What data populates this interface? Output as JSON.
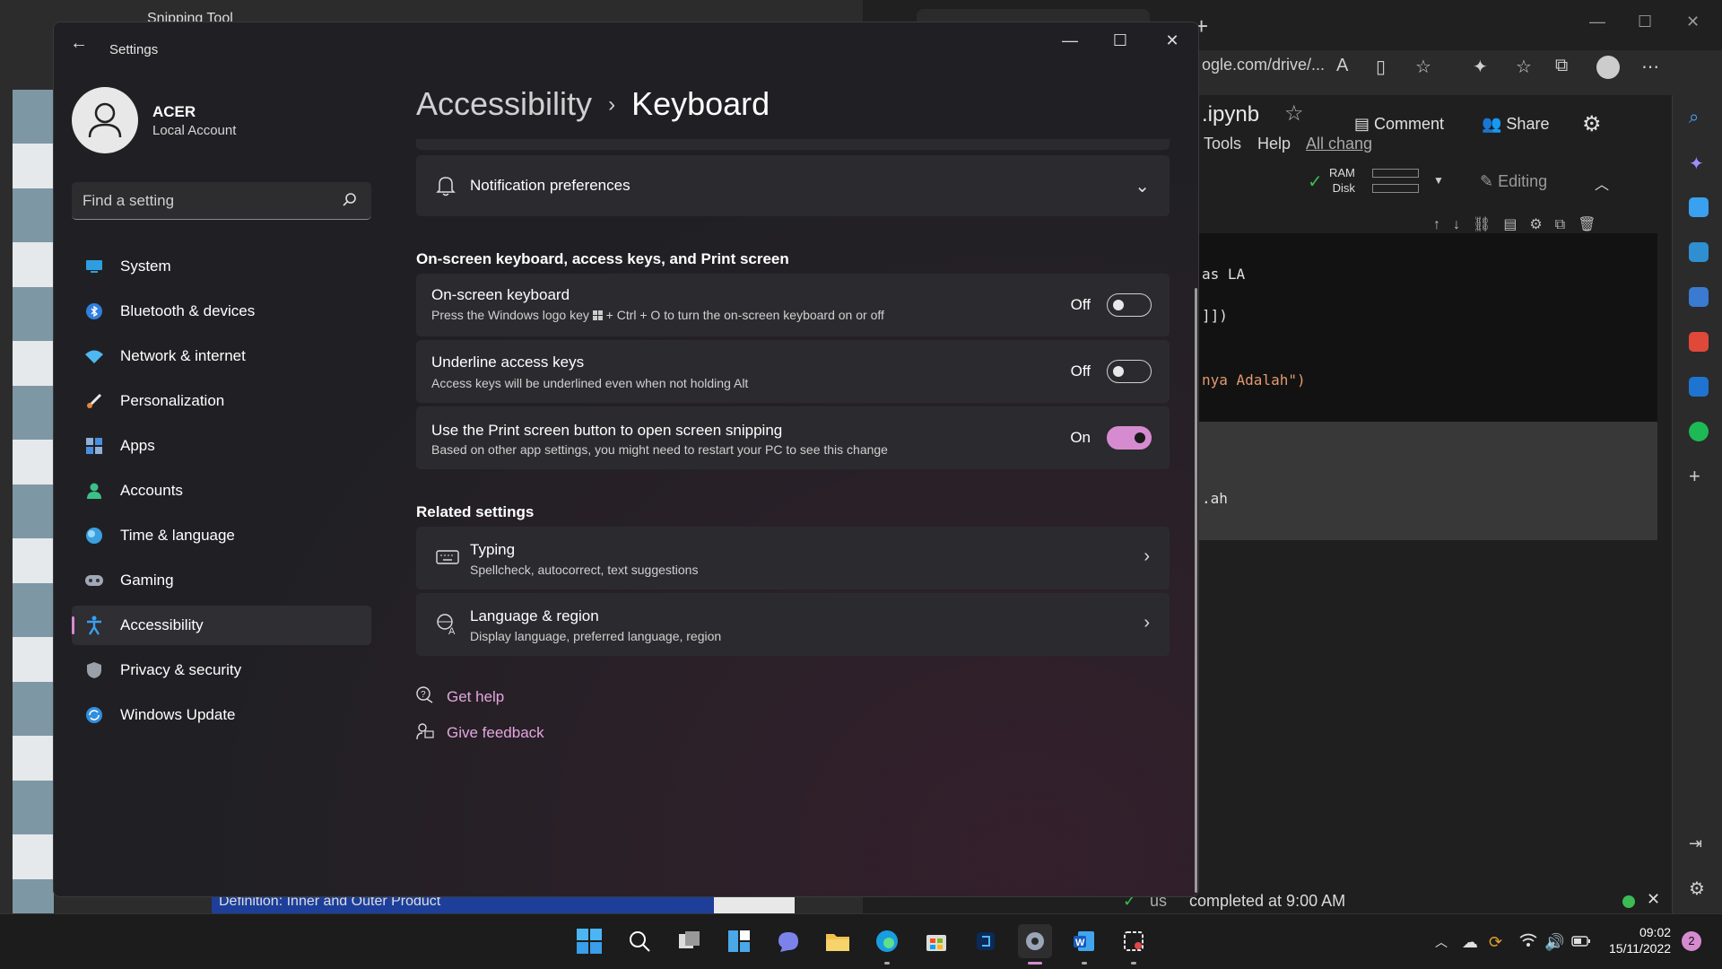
{
  "background": {
    "snipping_tool": {
      "title": "Snipping Tool",
      "definition_text": "Definition: Inner and Outer Product"
    },
    "browser": {
      "url": "ogle.com/drive/...",
      "notebook_title": ".ipynb",
      "menu": [
        "Tools",
        "Help"
      ],
      "all_changes": "All chang",
      "comment_label": "Comment",
      "share_label": "Share",
      "ram_label": "RAM",
      "disk_label": "Disk",
      "editing_label": "Editing",
      "code_lines": [
        "as LA",
        "]])",
        "nya Adalah\")",
        ".ah"
      ],
      "status_us": "us",
      "status_text": "completed at 9:00 AM"
    }
  },
  "settings": {
    "window_title": "Settings",
    "profile": {
      "name": "ACER",
      "account_type": "Local Account"
    },
    "search": {
      "placeholder": "Find a setting"
    },
    "nav": [
      {
        "label": "System",
        "icon": "system-icon",
        "color": "#2f9ee0"
      },
      {
        "label": "Bluetooth & devices",
        "icon": "bluetooth-icon",
        "color": "#2f7fe0"
      },
      {
        "label": "Network & internet",
        "icon": "wifi-icon",
        "color": "#4fb8f0"
      },
      {
        "label": "Personalization",
        "icon": "brush-icon",
        "color": "#e08a3c"
      },
      {
        "label": "Apps",
        "icon": "apps-icon",
        "color": "#8fb0d8"
      },
      {
        "label": "Accounts",
        "icon": "accounts-icon",
        "color": "#3cc08a"
      },
      {
        "label": "Time & language",
        "icon": "globe-clock-icon",
        "color": "#3aa0e0"
      },
      {
        "label": "Gaming",
        "icon": "gamepad-icon",
        "color": "#a0a8b8"
      },
      {
        "label": "Accessibility",
        "icon": "accessibility-icon",
        "color": "#3aa0f0",
        "selected": true
      },
      {
        "label": "Privacy & security",
        "icon": "shield-icon",
        "color": "#9aa0a8"
      },
      {
        "label": "Windows Update",
        "icon": "update-icon",
        "color": "#2f8fe0"
      }
    ],
    "breadcrumb": {
      "parent": "Accessibility",
      "separator": "›",
      "current": "Keyboard"
    },
    "notification": {
      "label": "Notification preferences"
    },
    "section_keyboard": "On-screen keyboard, access keys, and Print screen",
    "toggles": [
      {
        "title": "On-screen keyboard",
        "desc_prefix": "Press the Windows logo key",
        "desc_suffix": "+ Ctrl + O to turn the on-screen keyboard on or off",
        "state": "Off",
        "on": false
      },
      {
        "title": "Underline access keys",
        "desc": "Access keys will be underlined even when not holding Alt",
        "state": "Off",
        "on": false
      },
      {
        "title": "Use the Print screen button to open screen snipping",
        "desc": "Based on other app settings, you might need to restart your PC to see this change",
        "state": "On",
        "on": true
      }
    ],
    "section_related": "Related settings",
    "related": [
      {
        "title": "Typing",
        "desc": "Spellcheck, autocorrect, text suggestions"
      },
      {
        "title": "Language & region",
        "desc": "Display language, preferred language, region"
      }
    ],
    "help": {
      "get_help": "Get help",
      "give_feedback": "Give feedback"
    },
    "accent": "#d68bd0"
  },
  "taskbar": {
    "apps": [
      "start",
      "search",
      "task-view",
      "widgets",
      "chat",
      "file-explorer",
      "edge",
      "store",
      "app-8",
      "settings",
      "word",
      "snipping-tool"
    ],
    "time": "09:02",
    "date": "15/11/2022",
    "notification_count": "2"
  }
}
